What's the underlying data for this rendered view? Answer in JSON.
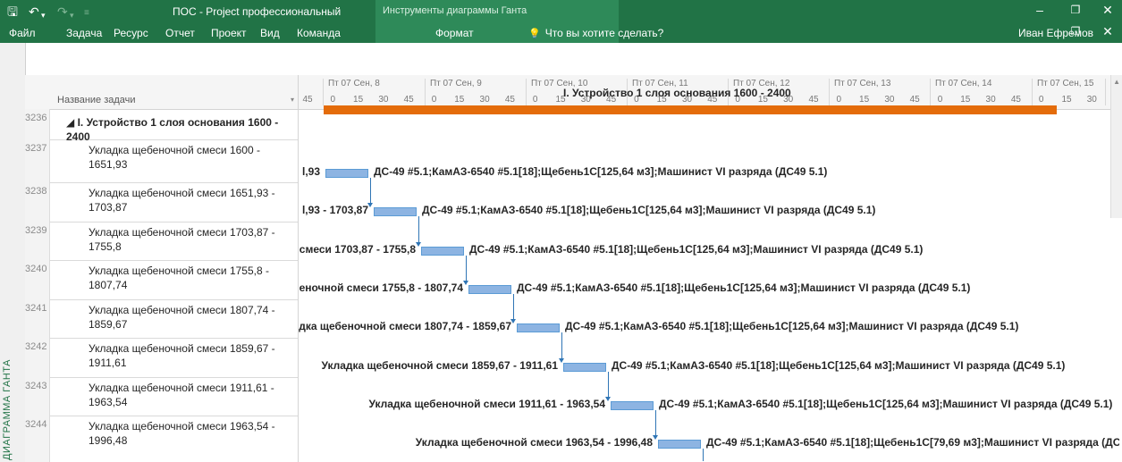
{
  "titlebar": {
    "app_title": "ПОС - Project профессиональный",
    "context_title": "Инструменты диаграммы Ганта",
    "user_name": "Иван Ефремов",
    "search_placeholder": "Что вы хотите сделать?",
    "menu": [
      "Файл",
      "Задача",
      "Ресурс",
      "Отчет",
      "Проект",
      "Вид",
      "Команда"
    ],
    "format_tab": "Формат"
  },
  "side_label": "ДИАГРАММА ГАНТА",
  "table": {
    "header": "Название задачи",
    "rows": [
      {
        "id": "3236",
        "name": "◢ I. Устройство 1 слоя основания 1600 - 2400",
        "summary": true
      },
      {
        "id": "3237",
        "name": "Укладка щебеночной смеси 1600 - 1651,93"
      },
      {
        "id": "3238",
        "name": "Укладка щебеночной смеси 1651,93 - 1703,87"
      },
      {
        "id": "3239",
        "name": "Укладка щебеночной смеси 1703,87 - 1755,8"
      },
      {
        "id": "3240",
        "name": "Укладка щебеночной смеси 1755,8 - 1807,74"
      },
      {
        "id": "3241",
        "name": "Укладка щебеночной смеси 1807,74 - 1859,67"
      },
      {
        "id": "3242",
        "name": "Укладка щебеночной смеси 1859,67 - 1911,61"
      },
      {
        "id": "3243",
        "name": "Укладка щебеночной смеси 1911,61 - 1963,54"
      },
      {
        "id": "3244",
        "name": "Укладка щебеночной смеси 1963,54 - 1996,48"
      }
    ]
  },
  "timescale": {
    "days": [
      "Пт 07 Сен, 8",
      "Пт 07 Сен, 9",
      "Пт 07 Сен, 10",
      "Пт 07 Сен, 11",
      "Пт 07 Сен, 12",
      "Пт 07 Сен, 13",
      "Пт 07 Сен, 14",
      "Пт 07 Сен, 15",
      "Пт 07"
    ],
    "minutes": [
      "45",
      "0",
      "15",
      "30",
      "45",
      "0",
      "15",
      "30",
      "45",
      "0",
      "15",
      "30",
      "45",
      "0",
      "15",
      "30",
      "45",
      "0",
      "15",
      "30",
      "45",
      "0",
      "15",
      "30",
      "45",
      "0",
      "15",
      "30",
      "45",
      "0",
      "15",
      "30",
      "45",
      "0"
    ]
  },
  "gantt": {
    "summary_label": "I. Устройство 1 слоя основания 1600 - 2400",
    "bars": [
      {
        "left": "l,93",
        "right": "ДС-49 #5.1;КамАЗ-6540 #5.1[18];Щебень1С[125,64 м3];Машинист VI разряда (ДС49 5.1)"
      },
      {
        "left": "l,93 - 1703,87",
        "right": "ДС-49 #5.1;КамАЗ-6540 #5.1[18];Щебень1С[125,64 м3];Машинист VI разряда (ДС49 5.1)"
      },
      {
        "left": "смеси 1703,87 - 1755,8",
        "right": "ДС-49 #5.1;КамАЗ-6540 #5.1[18];Щебень1С[125,64 м3];Машинист VI разряда (ДС49 5.1)"
      },
      {
        "left": "еночной смеси 1755,8 - 1807,74",
        "right": "ДС-49 #5.1;КамАЗ-6540 #5.1[18];Щебень1С[125,64 м3];Машинист VI разряда (ДС49 5.1)"
      },
      {
        "left": "дка щебеночной смеси 1807,74 - 1859,67",
        "right": "ДС-49 #5.1;КамАЗ-6540 #5.1[18];Щебень1С[125,64 м3];Машинист VI разряда (ДС49 5.1)"
      },
      {
        "left": "Укладка щебеночной смеси 1859,67 - 1911,61",
        "right": "ДС-49 #5.1;КамАЗ-6540 #5.1[18];Щебень1С[125,64 м3];Машинист VI разряда (ДС49 5.1)"
      },
      {
        "left": "Укладка щебеночной смеси 1911,61 - 1963,54",
        "right": "ДС-49 #5.1;КамАЗ-6540 #5.1[18];Щебень1С[125,64 м3];Машинист VI разряда (ДС49 5.1)"
      },
      {
        "left": "Укладка щебеночной смеси 1963,54 - 1996,48",
        "right": "ДС-49 #5.1;КамАЗ-6540 #5.1[18];Щебень1С[79,69 м3];Машинист VI разряда (ДС49"
      }
    ]
  },
  "colors": {
    "ribbon": "#217346",
    "summary_bar": "#e46c0a",
    "task_bar": "#8db4e2",
    "link": "#2f75b5"
  },
  "icons": {
    "save": "save-icon",
    "undo": "undo-icon",
    "redo": "redo-icon",
    "customize": "quick-access-dropdown-icon",
    "search": "lightbulb-icon",
    "minimize": "minimize-icon",
    "restore": "restore-icon",
    "close": "close-icon"
  }
}
